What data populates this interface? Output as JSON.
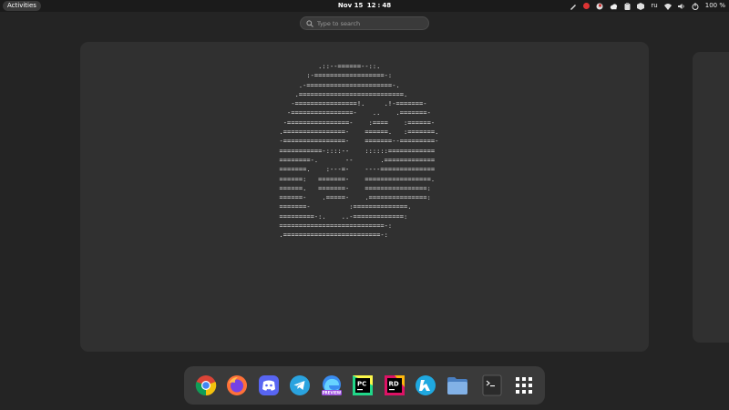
{
  "topbar": {
    "activities": "Activities",
    "date": "Nov 15",
    "hour": "12",
    "sep": ":",
    "minute": "48",
    "tray_icons": [
      "pen-icon",
      "app-indicator-red-icon",
      "flag-icon",
      "cloud-icon",
      "clipboard-icon",
      "cube-icon"
    ],
    "language": "ru",
    "status_icons": [
      "wifi-icon",
      "volume-icon",
      "power-icon"
    ],
    "battery": "100 %"
  },
  "search": {
    "placeholder": "Type to search"
  },
  "window": {
    "ascii_lines": [
      "            .::--======--::.",
      "         :-==================-:",
      "       .-======================-.",
      "      .===========================.",
      "     -================!.     .!-=======-",
      "    -================-    ..    .=======-",
      "   -================-    :====    :======-",
      "  .================-    ======.   :=======.",
      "  -================-    =======--=========-",
      "  ===========-::::--    ::::::============",
      "  ========-.       --       .=============",
      "  =======.    :---=-    ----==============",
      "  ======:   =======-    =================.",
      "  ======.   =======-    ================:",
      "  ======-    .=====-    .===============:",
      "  =======-          :==============.",
      "  =========-:.    ..-=============:",
      "  ===========================-:",
      "  .=========================-:"
    ]
  },
  "dock": {
    "apps": [
      {
        "name": "chrome-icon",
        "color": "#4285f4"
      },
      {
        "name": "firefox-icon",
        "color": "#ff7139"
      },
      {
        "name": "discord-icon",
        "color": "#5865f2"
      },
      {
        "name": "telegram-icon",
        "color": "#2aa3df"
      },
      {
        "name": "edge-preview-icon",
        "color": "#3a8cf0",
        "badge": "PREVIEW"
      },
      {
        "name": "pycharm-icon",
        "color": "#21d789",
        "text": "PC"
      },
      {
        "name": "rider-icon",
        "color": "#dd1265",
        "text": "RD"
      },
      {
        "name": "kde-connect-icon",
        "color": "#1fa8e0"
      },
      {
        "name": "files-icon",
        "color": "#6a9fd9"
      },
      {
        "name": "terminal-icon",
        "color": "#2b2b2b"
      },
      {
        "name": "app-grid-icon",
        "color": "#ffffff"
      }
    ]
  }
}
